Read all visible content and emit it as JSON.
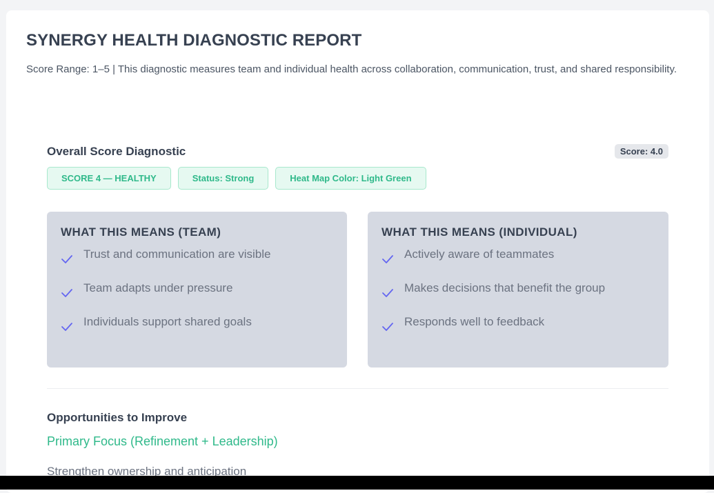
{
  "report": {
    "title": "SYNERGY HEALTH DIAGNOSTIC REPORT",
    "intro": "Score Range: 1–5 | This diagnostic measures team and individual health across collaboration, communication, trust, and shared responsibility."
  },
  "overall": {
    "title": "Overall Score Diagnostic",
    "score_label": "Score: 4.0",
    "tags": [
      "SCORE 4 — HEALTHY",
      "Status: Strong",
      "Heat Map Color: Light Green"
    ]
  },
  "team": {
    "title": "WHAT THIS MEANS (TEAM)",
    "items": [
      "Trust and communication are visible",
      "Team adapts under pressure",
      "Individuals support shared goals"
    ]
  },
  "individual": {
    "title": "WHAT THIS MEANS (INDIVIDUAL)",
    "items": [
      "Actively aware of teammates",
      "Makes decisions that benefit the group",
      "Responds well to feedback"
    ]
  },
  "opportunities": {
    "title": "Opportunities to Improve",
    "focus_title": "Primary Focus (Refinement + Leadership)",
    "focus_text": "Strengthen ownership and anticipation"
  },
  "colors": {
    "accent_green": "#2fb98a",
    "tag_background": "#e6f9f1",
    "panel_background": "#d5d9e2",
    "check_color": "#6366f1"
  },
  "icons": {
    "check": "checkmark-icon"
  }
}
